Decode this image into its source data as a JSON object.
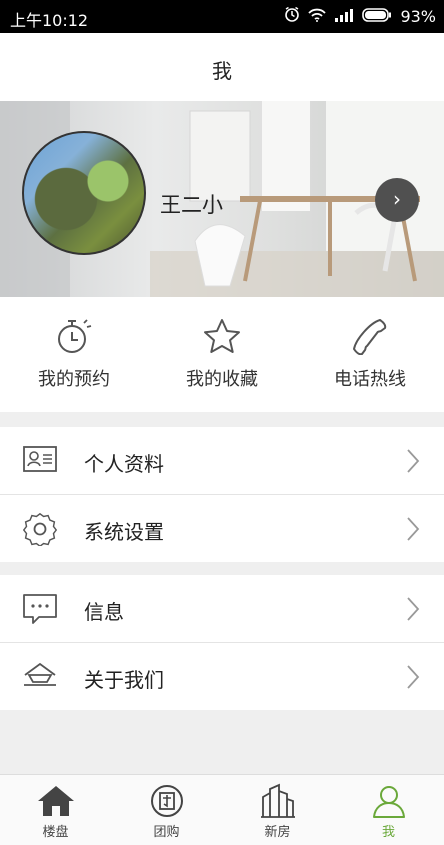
{
  "status_bar": {
    "time": "上午10:12",
    "battery": "93%"
  },
  "header": {
    "title": "我"
  },
  "profile": {
    "name": "王二小"
  },
  "quick_actions": [
    {
      "label": "我的预约",
      "icon": "stopwatch-icon"
    },
    {
      "label": "我的收藏",
      "icon": "star-icon"
    },
    {
      "label": "电话热线",
      "icon": "phone-icon"
    }
  ],
  "menu_group_1": [
    {
      "label": "个人资料",
      "icon": "id-card-icon"
    },
    {
      "label": "系统设置",
      "icon": "gear-icon"
    }
  ],
  "menu_group_2": [
    {
      "label": "信息",
      "icon": "message-icon"
    },
    {
      "label": "关于我们",
      "icon": "about-icon"
    }
  ],
  "tab_bar": {
    "tabs": [
      {
        "label": "楼盘",
        "icon": "house-icon"
      },
      {
        "label": "团购",
        "icon": "group-buy-icon"
      },
      {
        "label": "新房",
        "icon": "buildings-icon"
      },
      {
        "label": "我",
        "icon": "user-icon"
      }
    ],
    "active_color": "#6aa83a"
  }
}
